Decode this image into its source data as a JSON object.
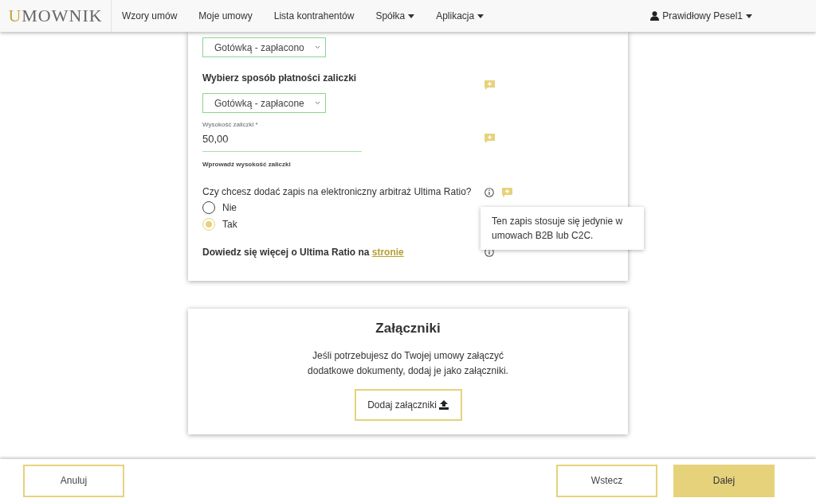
{
  "nav": {
    "logo": "UMOWNIK",
    "items": [
      {
        "label": "Wzory umów",
        "dropdown": false
      },
      {
        "label": "Moje umowy",
        "dropdown": false
      },
      {
        "label": "Lista kontrahentów",
        "dropdown": false
      },
      {
        "label": "Spółka",
        "dropdown": true
      },
      {
        "label": "Aplikacja",
        "dropdown": true
      }
    ],
    "user": {
      "label": "Prawidłowy Pesel1",
      "dropdown": true
    }
  },
  "form": {
    "rows": [
      {
        "kind": "select",
        "value": "Gotówką - zapłacono"
      },
      {
        "kind": "heading",
        "text": "Wybierz sposób płatności zaliczki",
        "comment": true
      },
      {
        "kind": "select",
        "value": "Gotówką - zapłacone"
      },
      {
        "kind": "input",
        "label": "Wysokość zaliczki *",
        "value": "50,00",
        "hint": "Wprowadź wysokość zaliczki",
        "comment": true
      },
      {
        "kind": "radio",
        "question": "Czy chcesz dodać zapis na elektroniczny arbitraż Ultima Ratio?",
        "info": true,
        "comment": true,
        "options": [
          {
            "label": "Nie",
            "selected": false
          },
          {
            "label": "Tak",
            "selected": true
          }
        ],
        "tooltip": "Ten zapis stosuje się jedynie w umowach B2B lub C2C."
      },
      {
        "kind": "link_text",
        "text": "Dowiedz się więcej o Ultima Ratio na ",
        "link": "stronie",
        "info": true
      }
    ]
  },
  "attachments": {
    "title": "Załączniki",
    "text": "Jeśli potrzebujesz do Twojej umowy załączyć dodatkowe dokumenty, dodaj je jako załączniki.",
    "button": "Dodaj załączniki"
  },
  "footer": {
    "cancel": "Anuluj",
    "back": "Wstecz",
    "next": "Dalej"
  }
}
